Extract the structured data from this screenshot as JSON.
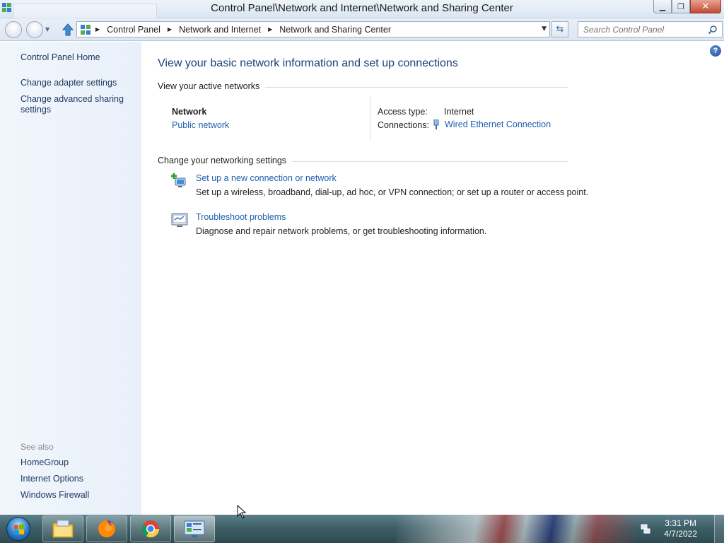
{
  "window": {
    "title": "Control Panel\\Network and Internet\\Network and Sharing Center"
  },
  "navbar": {
    "breadcrumb": [
      "Control Panel",
      "Network and Internet",
      "Network and Sharing Center"
    ],
    "search_placeholder": "Search Control Panel"
  },
  "sidebar": {
    "items": [
      {
        "label": "Control Panel Home"
      },
      {
        "label": "Change adapter settings"
      },
      {
        "label": "Change advanced sharing settings"
      }
    ],
    "see_also_title": "See also",
    "see_also": [
      {
        "label": "HomeGroup"
      },
      {
        "label": "Internet Options"
      },
      {
        "label": "Windows Firewall"
      }
    ]
  },
  "main": {
    "heading": "View your basic network information and set up connections",
    "active_networks_label": "View your active networks",
    "network": {
      "name": "Network",
      "type": "Public network",
      "access_type_label": "Access type:",
      "access_type_value": "Internet",
      "connections_label": "Connections:",
      "connection_value": "Wired Ethernet Connection"
    },
    "change_settings_label": "Change your networking settings",
    "tasks": [
      {
        "title": "Set up a new connection or network",
        "desc": "Set up a wireless, broadband, dial-up, ad hoc, or VPN connection; or set up a router or access point.",
        "icon": "new-connection-icon"
      },
      {
        "title": "Troubleshoot problems",
        "desc": "Diagnose and repair network problems, or get troubleshooting information.",
        "icon": "troubleshoot-icon"
      }
    ]
  },
  "taskbar": {
    "time": "3:31 PM",
    "date": "4/7/2022",
    "pinned": [
      "explorer-icon",
      "firefox-icon",
      "chrome-icon",
      "control-panel-icon"
    ]
  },
  "colors": {
    "link": "#1f5fad",
    "heading": "#1c3f7c",
    "sidebar_bg": "#eef4fb"
  }
}
